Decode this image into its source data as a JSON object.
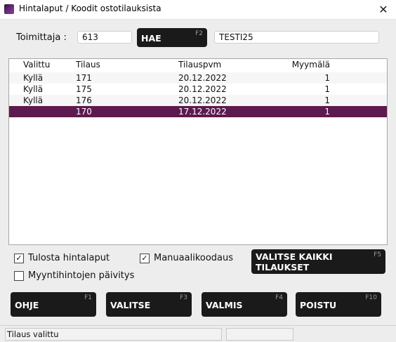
{
  "window": {
    "title": "Hintalaput / Koodit ostotilauksista"
  },
  "search": {
    "supplier_label": "Toimittaja :",
    "supplier_value": "613",
    "search_button": "HAE",
    "search_key": "F2",
    "supplier_name": "TESTI25"
  },
  "table": {
    "columns": [
      "Valittu",
      "Tilaus",
      "Tilauspvm",
      "Myymälä"
    ],
    "rows": [
      {
        "selected": "Kyllä",
        "order": "171",
        "date": "20.12.2022",
        "store": "1"
      },
      {
        "selected": "Kyllä",
        "order": "175",
        "date": "20.12.2022",
        "store": "1"
      },
      {
        "selected": "Kyllä",
        "order": "176",
        "date": "20.12.2022",
        "store": "1"
      },
      {
        "selected": "",
        "order": "170",
        "date": "17.12.2022",
        "store": "1"
      }
    ]
  },
  "options": {
    "print_labels": {
      "label": "Tulosta hintalaput",
      "checked": true
    },
    "price_update": {
      "label": "Myyntihintojen päivitys",
      "checked": false
    },
    "manual_coding": {
      "label": "Manuaalikoodaus",
      "checked": true
    },
    "select_all_line1": "VALITSE KAIKKI",
    "select_all_line2": "TILAUKSET",
    "select_all_key": "F5"
  },
  "buttons": [
    {
      "label": "OHJE",
      "key": "F1"
    },
    {
      "label": "VALITSE",
      "key": "F3"
    },
    {
      "label": "VALMIS",
      "key": "F4"
    },
    {
      "label": "POISTU",
      "key": "F10"
    }
  ],
  "status": {
    "text": "Tilaus valittu",
    "cell2": ""
  },
  "colors": {
    "selected_row": "#5c1a4e",
    "button_bg": "#1a1a1a"
  }
}
